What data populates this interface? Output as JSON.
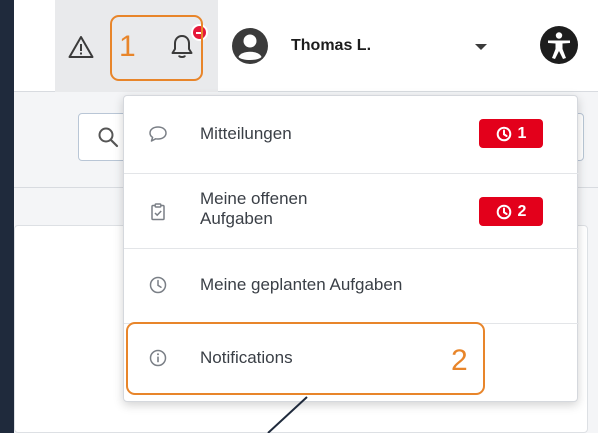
{
  "header": {
    "user_name": "Thomas L.",
    "icons": {
      "warning": "warning-icon",
      "bell": "bell-icon",
      "avatar": "user-avatar-icon",
      "caret": "caret-down-icon",
      "accessibility": "accessibility-icon"
    }
  },
  "annotations": {
    "one": "1",
    "two": "2"
  },
  "dropdown": {
    "items": [
      {
        "label": "Mitteilungen",
        "icon": "chat-bubble-icon",
        "badge": "1"
      },
      {
        "label_line1": "Meine offenen",
        "label_line2": "Aufgaben",
        "icon": "clipboard-check-icon",
        "badge": "2"
      },
      {
        "label": "Meine geplanten Aufgaben",
        "icon": "clock-icon"
      },
      {
        "label": "Notifications",
        "icon": "info-icon"
      }
    ]
  },
  "colors": {
    "accent_orange": "#e8852a",
    "badge_red": "#e3001b",
    "frame_dark": "#1f2a3c"
  }
}
